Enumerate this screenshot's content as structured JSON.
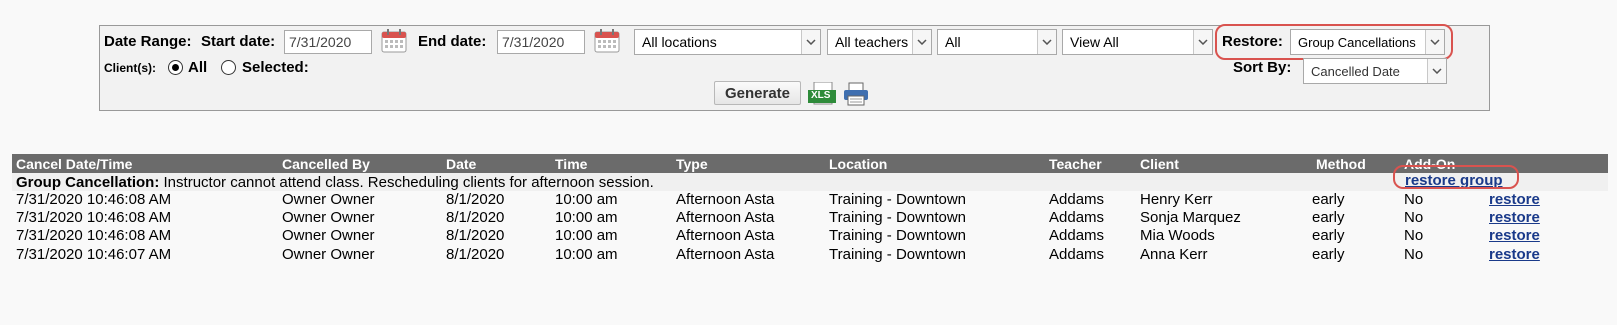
{
  "filters": {
    "date_range_label": "Date Range:",
    "start_label": "Start date:",
    "start_value": "7/31/2020",
    "end_label": "End date:",
    "end_value": "7/31/2020",
    "location_select": "All locations",
    "teacher_select": "All teachers",
    "type_select": "All",
    "view_select": "View All",
    "restore_label": "Restore:",
    "restore_select": "Group Cancellations",
    "clients_label": "Client(s):",
    "all_label": "All",
    "selected_label": "Selected:",
    "sort_label": "Sort By:",
    "sort_select": "Cancelled Date",
    "generate_label": "Generate",
    "xls_label": "XLS",
    "client_mode": "All"
  },
  "table": {
    "columns": [
      "Cancel Date/Time",
      "Cancelled By",
      "Date",
      "Time",
      "Type",
      "Location",
      "Teacher",
      "Client",
      "Method",
      "Add-On"
    ],
    "group": {
      "title": "Group Cancellation:",
      "note": "Instructor cannot attend class. Rescheduling clients for afternoon session.",
      "restore_label": "restore group"
    },
    "rows": [
      {
        "cancel": "7/31/2020 10:46:08 AM",
        "by": "Owner Owner",
        "date": "8/1/2020",
        "time": "10:00 am",
        "type": "Afternoon Asta",
        "location": "Training - Downtown",
        "teacher": "Addams",
        "client": "Henry Kerr",
        "method": "early",
        "addon": "No",
        "action": "restore"
      },
      {
        "cancel": "7/31/2020 10:46:08 AM",
        "by": "Owner Owner",
        "date": "8/1/2020",
        "time": "10:00 am",
        "type": "Afternoon Asta",
        "location": "Training - Downtown",
        "teacher": "Addams",
        "client": "Sonja Marquez",
        "method": "early",
        "addon": "No",
        "action": "restore"
      },
      {
        "cancel": "7/31/2020 10:46:08 AM",
        "by": "Owner Owner",
        "date": "8/1/2020",
        "time": "10:00 am",
        "type": "Afternoon Asta",
        "location": "Training - Downtown",
        "teacher": "Addams",
        "client": "Mia Woods",
        "method": "early",
        "addon": "No",
        "action": "restore"
      },
      {
        "cancel": "7/31/2020 10:46:07 AM",
        "by": "Owner Owner",
        "date": "8/1/2020",
        "time": "10:00 am",
        "type": "Afternoon Asta",
        "location": "Training - Downtown",
        "teacher": "Addams",
        "client": "Anna Kerr",
        "method": "early",
        "addon": "No",
        "action": "restore"
      }
    ]
  },
  "colors": {
    "highlight": "#d9534f",
    "header_bg": "#6b6b6b",
    "link": "#1a3a8a"
  }
}
